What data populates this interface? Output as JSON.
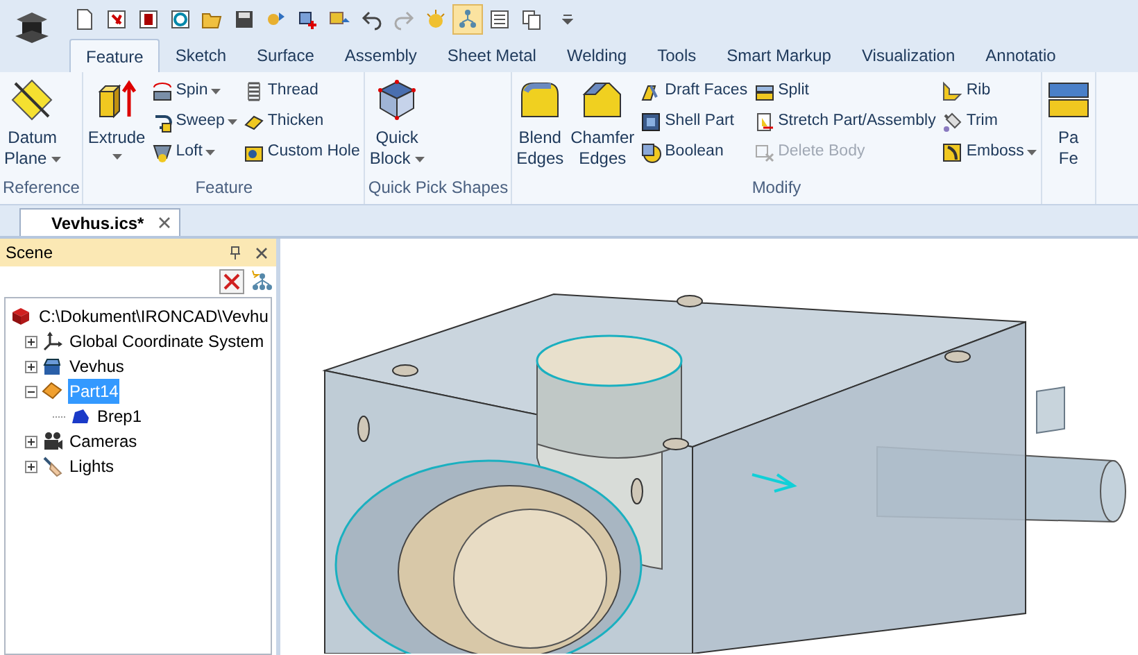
{
  "tabs": [
    {
      "label": "Feature",
      "selected": true
    },
    {
      "label": "Sketch",
      "selected": false
    },
    {
      "label": "Surface",
      "selected": false
    },
    {
      "label": "Assembly",
      "selected": false
    },
    {
      "label": "Sheet Metal",
      "selected": false
    },
    {
      "label": "Welding",
      "selected": false
    },
    {
      "label": "Tools",
      "selected": false
    },
    {
      "label": "Smart Markup",
      "selected": false
    },
    {
      "label": "Visualization",
      "selected": false
    },
    {
      "label": "Annotatio",
      "selected": false
    }
  ],
  "ribbon": {
    "groups": [
      {
        "label": "Reference",
        "items": [
          {
            "kind": "large",
            "lines": [
              "Datum",
              "Plane"
            ],
            "dropdown": true
          }
        ]
      },
      {
        "label": "Feature",
        "items": [
          {
            "kind": "large",
            "lines": [
              "Extrude"
            ],
            "dropdown": true
          },
          {
            "kind": "column",
            "items": [
              {
                "label": "Spin",
                "dropdown": true,
                "disabled": false
              },
              {
                "label": "Sweep",
                "dropdown": true,
                "disabled": false
              },
              {
                "label": "Loft",
                "dropdown": true,
                "disabled": false
              }
            ]
          },
          {
            "kind": "column",
            "items": [
              {
                "label": "Thread",
                "dropdown": false,
                "disabled": false
              },
              {
                "label": "Thicken",
                "dropdown": false,
                "disabled": false
              },
              {
                "label": "Custom Hole",
                "dropdown": false,
                "disabled": false
              }
            ]
          }
        ]
      },
      {
        "label": "Quick Pick Shapes",
        "items": [
          {
            "kind": "large",
            "lines": [
              "Quick",
              "Block"
            ],
            "dropdown": true
          }
        ]
      },
      {
        "label": "Modify",
        "items": [
          {
            "kind": "large",
            "lines": [
              "Blend",
              "Edges"
            ],
            "dropdown": false
          },
          {
            "kind": "large",
            "lines": [
              "Chamfer",
              "Edges"
            ],
            "dropdown": false
          },
          {
            "kind": "column",
            "items": [
              {
                "label": "Draft Faces",
                "dropdown": false,
                "disabled": false
              },
              {
                "label": "Shell Part",
                "dropdown": false,
                "disabled": false
              },
              {
                "label": "Boolean",
                "dropdown": false,
                "disabled": false
              }
            ]
          },
          {
            "kind": "column",
            "items": [
              {
                "label": "Split",
                "dropdown": false,
                "disabled": false
              },
              {
                "label": "Stretch Part/Assembly",
                "dropdown": false,
                "disabled": false
              },
              {
                "label": "Delete Body",
                "dropdown": false,
                "disabled": true
              }
            ]
          },
          {
            "kind": "column",
            "items": [
              {
                "label": "Rib",
                "dropdown": false,
                "disabled": false
              },
              {
                "label": "Trim",
                "dropdown": false,
                "disabled": false
              },
              {
                "label": "Emboss",
                "dropdown": true,
                "disabled": false
              }
            ]
          }
        ]
      },
      {
        "items": [
          {
            "kind": "large",
            "lines": [
              "Pa",
              "Fe"
            ],
            "dropdown": false
          }
        ]
      }
    ]
  },
  "document_tab": {
    "label": "Vevhus.ics*"
  },
  "scene": {
    "title": "Scene",
    "tree": [
      {
        "label": "C:\\Dokument\\IRONCAD\\Vevhu",
        "selected": false,
        "children": [
          {
            "label": "Global Coordinate System",
            "expanded": false,
            "selected": false
          },
          {
            "label": "Vevhus",
            "expanded": false,
            "selected": false
          },
          {
            "label": "Part14",
            "expanded": true,
            "selected": true,
            "children": [
              {
                "label": "Brep1",
                "selected": false
              }
            ]
          },
          {
            "label": "Cameras",
            "expanded": false,
            "selected": false
          },
          {
            "label": "Lights",
            "expanded": false,
            "selected": false
          }
        ]
      }
    ]
  }
}
